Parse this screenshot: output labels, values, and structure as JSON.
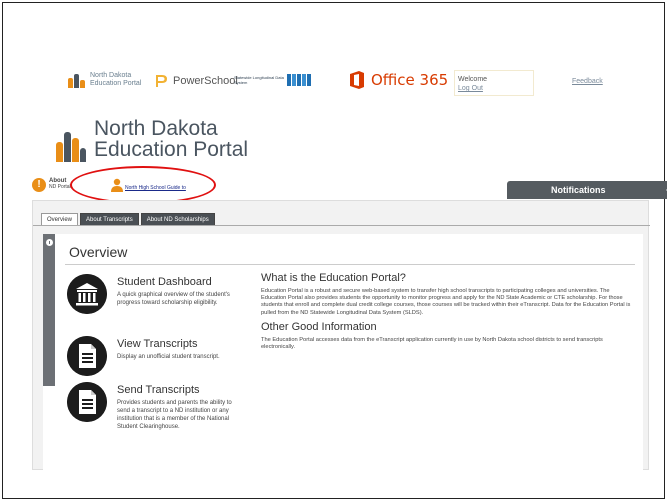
{
  "logo_bar": {
    "nd_portal_line1": "North Dakota",
    "nd_portal_line2": "Education Portal",
    "powerschool": "PowerSchool",
    "slds_text": "Statewide Longitudinal Data System",
    "office365": "Office 365",
    "welcome": "Welcome",
    "logout": "Log Out",
    "feedback": "Feedback"
  },
  "logo": {
    "line1": "North Dakota",
    "line2": "Education Portal"
  },
  "about": {
    "badge": "!",
    "title": "About",
    "subtitle": "ND Portal",
    "guide_link": "North High School Guide to"
  },
  "notifications": {
    "label": "Notifications"
  },
  "tabs": [
    {
      "label": "Overview"
    },
    {
      "label": "About Transcripts"
    },
    {
      "label": "About ND Scholarships"
    }
  ],
  "overview": {
    "title": "Overview",
    "features": [
      {
        "title": "Student Dashboard",
        "desc": "A quick graphical overview of the student's progress toward scholarship eligibility."
      },
      {
        "title": "View Transcripts",
        "desc": "Display an unofficial student transcript."
      },
      {
        "title": "Send Transcripts",
        "desc": "Provides students and parents the ability to send a transcript to a ND institution or any institution that is a member of the National Student Clearinghouse."
      }
    ],
    "what_title": "What is the Education Portal?",
    "what_body": "Education Portal is a robust and secure web-based system to transfer high school transcripts to participating colleges and universities. The Education Portal also provides students the opportunity to monitor progress and apply for the ND State Academic or CTE scholarship. For those students that enroll and complete dual credit college courses, those courses will be tracked within their eTranscript. Data for the Education Portal is pulled from the ND Statewide Longitudinal Data System (SLDS).",
    "other_title": "Other Good Information",
    "other_body": "The Education Portal accesses data from the eTranscript application currently in use by North Dakota school districts to send transcripts electronically."
  },
  "colors": {
    "accent_orange": "#e98e17",
    "highlight_red": "#e01010",
    "notif_bg": "#555b60",
    "office_red": "#d83b01"
  }
}
